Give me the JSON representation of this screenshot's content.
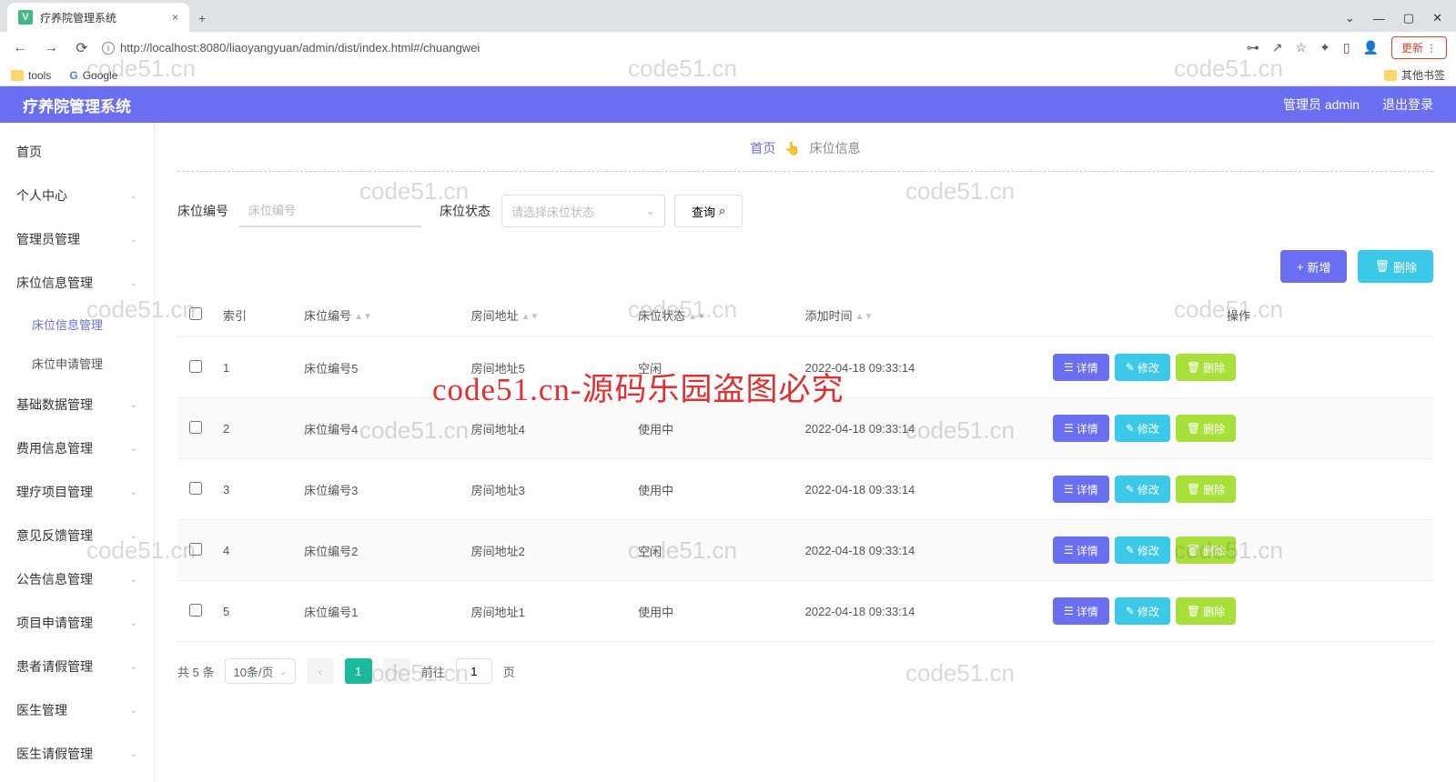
{
  "browser": {
    "tab_title": "疗养院管理系统",
    "url": "http://localhost:8080/liaoyangyuan/admin/dist/index.html#/chuangwei",
    "update_label": "更新",
    "bookmarks": {
      "tools": "tools",
      "google": "Google",
      "other": "其他书签"
    }
  },
  "header": {
    "title": "疗养院管理系统",
    "user_label": "管理员 admin",
    "logout_label": "退出登录"
  },
  "sidebar": {
    "items": [
      {
        "label": "首页"
      },
      {
        "label": "个人中心"
      },
      {
        "label": "管理员管理"
      },
      {
        "label": "床位信息管理",
        "expanded": true,
        "children": [
          {
            "label": "床位信息管理",
            "active": true
          },
          {
            "label": "床位申请管理"
          }
        ]
      },
      {
        "label": "基础数据管理"
      },
      {
        "label": "费用信息管理"
      },
      {
        "label": "理疗项目管理"
      },
      {
        "label": "意见反馈管理"
      },
      {
        "label": "公告信息管理"
      },
      {
        "label": "项目申请管理"
      },
      {
        "label": "患者请假管理"
      },
      {
        "label": "医生管理"
      },
      {
        "label": "医生请假管理"
      }
    ]
  },
  "breadcrumb": {
    "home": "首页",
    "sep": "👆",
    "current": "床位信息"
  },
  "filter": {
    "label_bedno": "床位编号",
    "placeholder_bedno": "床位编号",
    "label_status": "床位状态",
    "placeholder_status": "请选择床位状态",
    "query_label": "查询"
  },
  "actions": {
    "add": "新增",
    "delete": "删除"
  },
  "table": {
    "headers": {
      "index": "索引",
      "bedno": "床位编号",
      "addr": "房间地址",
      "status": "床位状态",
      "time": "添加时间",
      "ops": "操作"
    },
    "rows": [
      {
        "index": "1",
        "bedno": "床位编号5",
        "addr": "房间地址5",
        "status": "空闲",
        "time": "2022-04-18 09:33:14"
      },
      {
        "index": "2",
        "bedno": "床位编号4",
        "addr": "房间地址4",
        "status": "使用中",
        "time": "2022-04-18 09:33:14"
      },
      {
        "index": "3",
        "bedno": "床位编号3",
        "addr": "房间地址3",
        "status": "使用中",
        "time": "2022-04-18 09:33:14"
      },
      {
        "index": "4",
        "bedno": "床位编号2",
        "addr": "房间地址2",
        "status": "空闲",
        "time": "2022-04-18 09:33:14"
      },
      {
        "index": "5",
        "bedno": "床位编号1",
        "addr": "房间地址1",
        "status": "使用中",
        "time": "2022-04-18 09:33:14"
      }
    ],
    "row_ops": {
      "detail": "详情",
      "edit": "修改",
      "delete": "删除"
    }
  },
  "pager": {
    "total": "共 5 条",
    "per_page": "10条/页",
    "current": "1",
    "goto_prefix": "前往",
    "goto_value": "1",
    "goto_suffix": "页"
  },
  "watermark": {
    "text": "code51.cn",
    "red": "code51.cn-源码乐园盗图必究"
  }
}
